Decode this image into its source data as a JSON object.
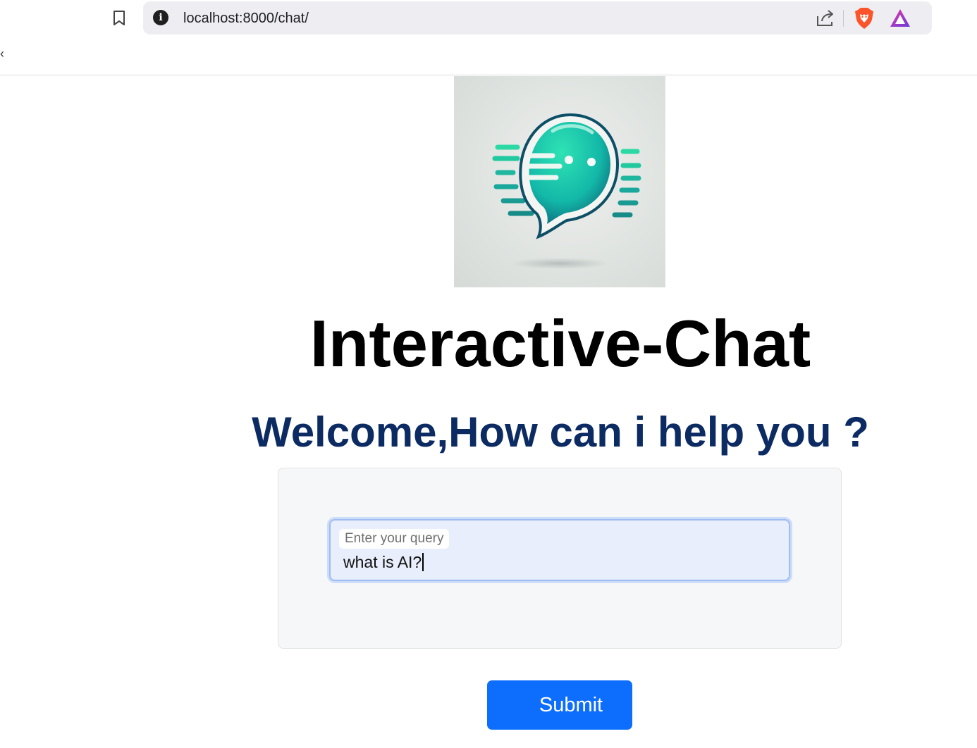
{
  "browser": {
    "url": "localhost:8000/chat/",
    "site_info_glyph": "i",
    "back_glyph": "‹",
    "icons": [
      "bookmark-icon",
      "info-icon",
      "share-icon",
      "brave-shields-icon",
      "brave-rewards-icon"
    ]
  },
  "app": {
    "title": "Interactive-Chat",
    "subtitle": "Welcome,How can i help you ?",
    "logo": "chat-bubble-logo"
  },
  "query": {
    "label": "Enter your query",
    "value": "what is AI?"
  },
  "actions": {
    "submit_label": "Submit"
  },
  "colors": {
    "accent": "#0d6efd",
    "subtitle": "#0c2b63",
    "logo_teal": "#19c6a7",
    "brave_orange": "#fb542b"
  }
}
